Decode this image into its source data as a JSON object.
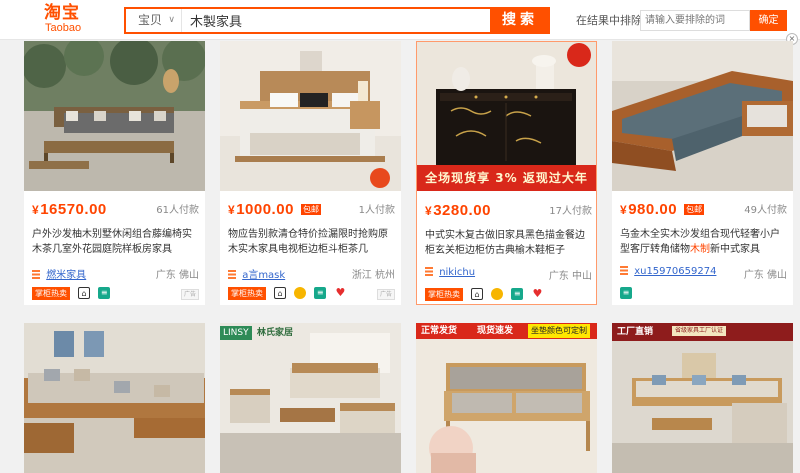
{
  "header": {
    "logo_zh": "淘宝",
    "logo_en": "Taobao",
    "search_category": "宝贝",
    "search_value": "木製家具",
    "search_button": "搜索",
    "exclude_label": "在结果中排除",
    "exclude_placeholder": "请输入要排除的词",
    "confirm_button": "确定",
    "close_label": "×"
  },
  "products": [
    {
      "price": "16570.00",
      "sales": "61人付款",
      "title_before": "户外沙发柚木别墅休闲组合藤编椅实木茶几室外花园庭院样板房家具",
      "title_keyword": "",
      "title_after": "",
      "shop": "燃米家具",
      "location": "广东 佛山",
      "baoyou": ""
    },
    {
      "price": "1000.00",
      "sales": "1人付款",
      "title_before": "物应告别款清仓特价捡漏限时抢购原木实木家具电视柜边柜斗柜茶几",
      "title_keyword": "",
      "title_after": "",
      "shop": "a言mask",
      "location": "浙江 杭州",
      "baoyou": "包邮"
    },
    {
      "price": "3280.00",
      "sales": "17人付款",
      "title_before": "中式实木复古做旧家具黑色描金餐边柜玄关柜边柜仿古典榆木鞋柜子",
      "title_keyword": "",
      "title_after": "",
      "shop": "nikichu",
      "location": "广东 中山",
      "baoyou": "",
      "banner": "全场现货享 3% 返现过大年"
    },
    {
      "price": "980.00",
      "sales": "49人付款",
      "title_before": "乌金木全实木沙发组合现代轻奢小户型客厅转角储物",
      "title_keyword": "木制",
      "title_after": "新中式家具",
      "shop": "xu15970659274",
      "location": "广东 佛山",
      "baoyou": "包邮"
    }
  ],
  "row2_tags": {
    "linsy_brand": "LINSY",
    "linsy_name": "林氏家居",
    "card3_tag_a": "正常发货",
    "card3_tag_b": "现货速发",
    "card3_tag_c": "坐垫颜色可定制",
    "card4_tag": "工厂直销",
    "card4_tag_b": "省级家具工厂认证"
  },
  "badges": {
    "zhanggui": "掌柜热卖",
    "ad": "广告"
  }
}
